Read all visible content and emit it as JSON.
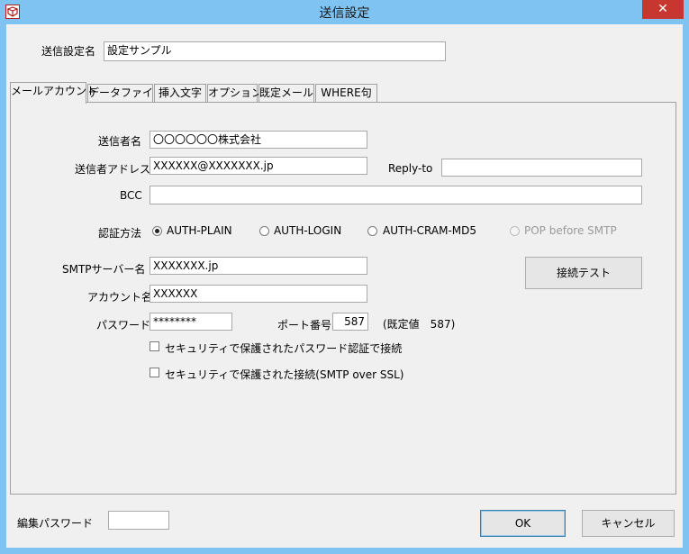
{
  "window": {
    "title": "送信設定",
    "close_glyph": "✕"
  },
  "setting_name": {
    "label": "送信設定名",
    "value": "設定サンプル"
  },
  "tabs": [
    {
      "label": "メールアカウント"
    },
    {
      "label": "データファイル"
    },
    {
      "label": "挿入文字"
    },
    {
      "label": "オプション"
    },
    {
      "label": "既定メール"
    },
    {
      "label": "WHERE句"
    }
  ],
  "account": {
    "sender_name_label": "送信者名",
    "sender_name_value": "〇〇〇〇〇〇株式会社",
    "sender_address_label": "送信者アドレス",
    "sender_address_value": "XXXXXX@XXXXXXX.jp",
    "reply_to_label": "Reply-to",
    "reply_to_value": "",
    "bcc_label": "BCC",
    "bcc_value": "",
    "auth_label": "認証方法",
    "auth_options": [
      "AUTH-PLAIN",
      "AUTH-LOGIN",
      "AUTH-CRAM-MD5",
      "POP before SMTP"
    ],
    "auth_selected": "AUTH-PLAIN",
    "smtp_label": "SMTPサーバー名",
    "smtp_value": "XXXXXXX.jp",
    "account_label": "アカウント名",
    "account_value": "XXXXXX",
    "password_label": "パスワード",
    "password_value": "********",
    "port_label": "ポート番号",
    "port_value": "587",
    "port_default": "(既定値　587)",
    "connect_test_button": "接続テスト",
    "secure_password_label": "セキュリティで保護されたパスワード認証で接続",
    "secure_password_checked": false,
    "ssl_label": "セキュリティで保護された接続(SMTP over SSL)",
    "ssl_checked": false
  },
  "footer": {
    "edit_password_label": "編集パスワード",
    "edit_password_value": "",
    "ok_button": "OK",
    "cancel_button": "キャンセル"
  }
}
